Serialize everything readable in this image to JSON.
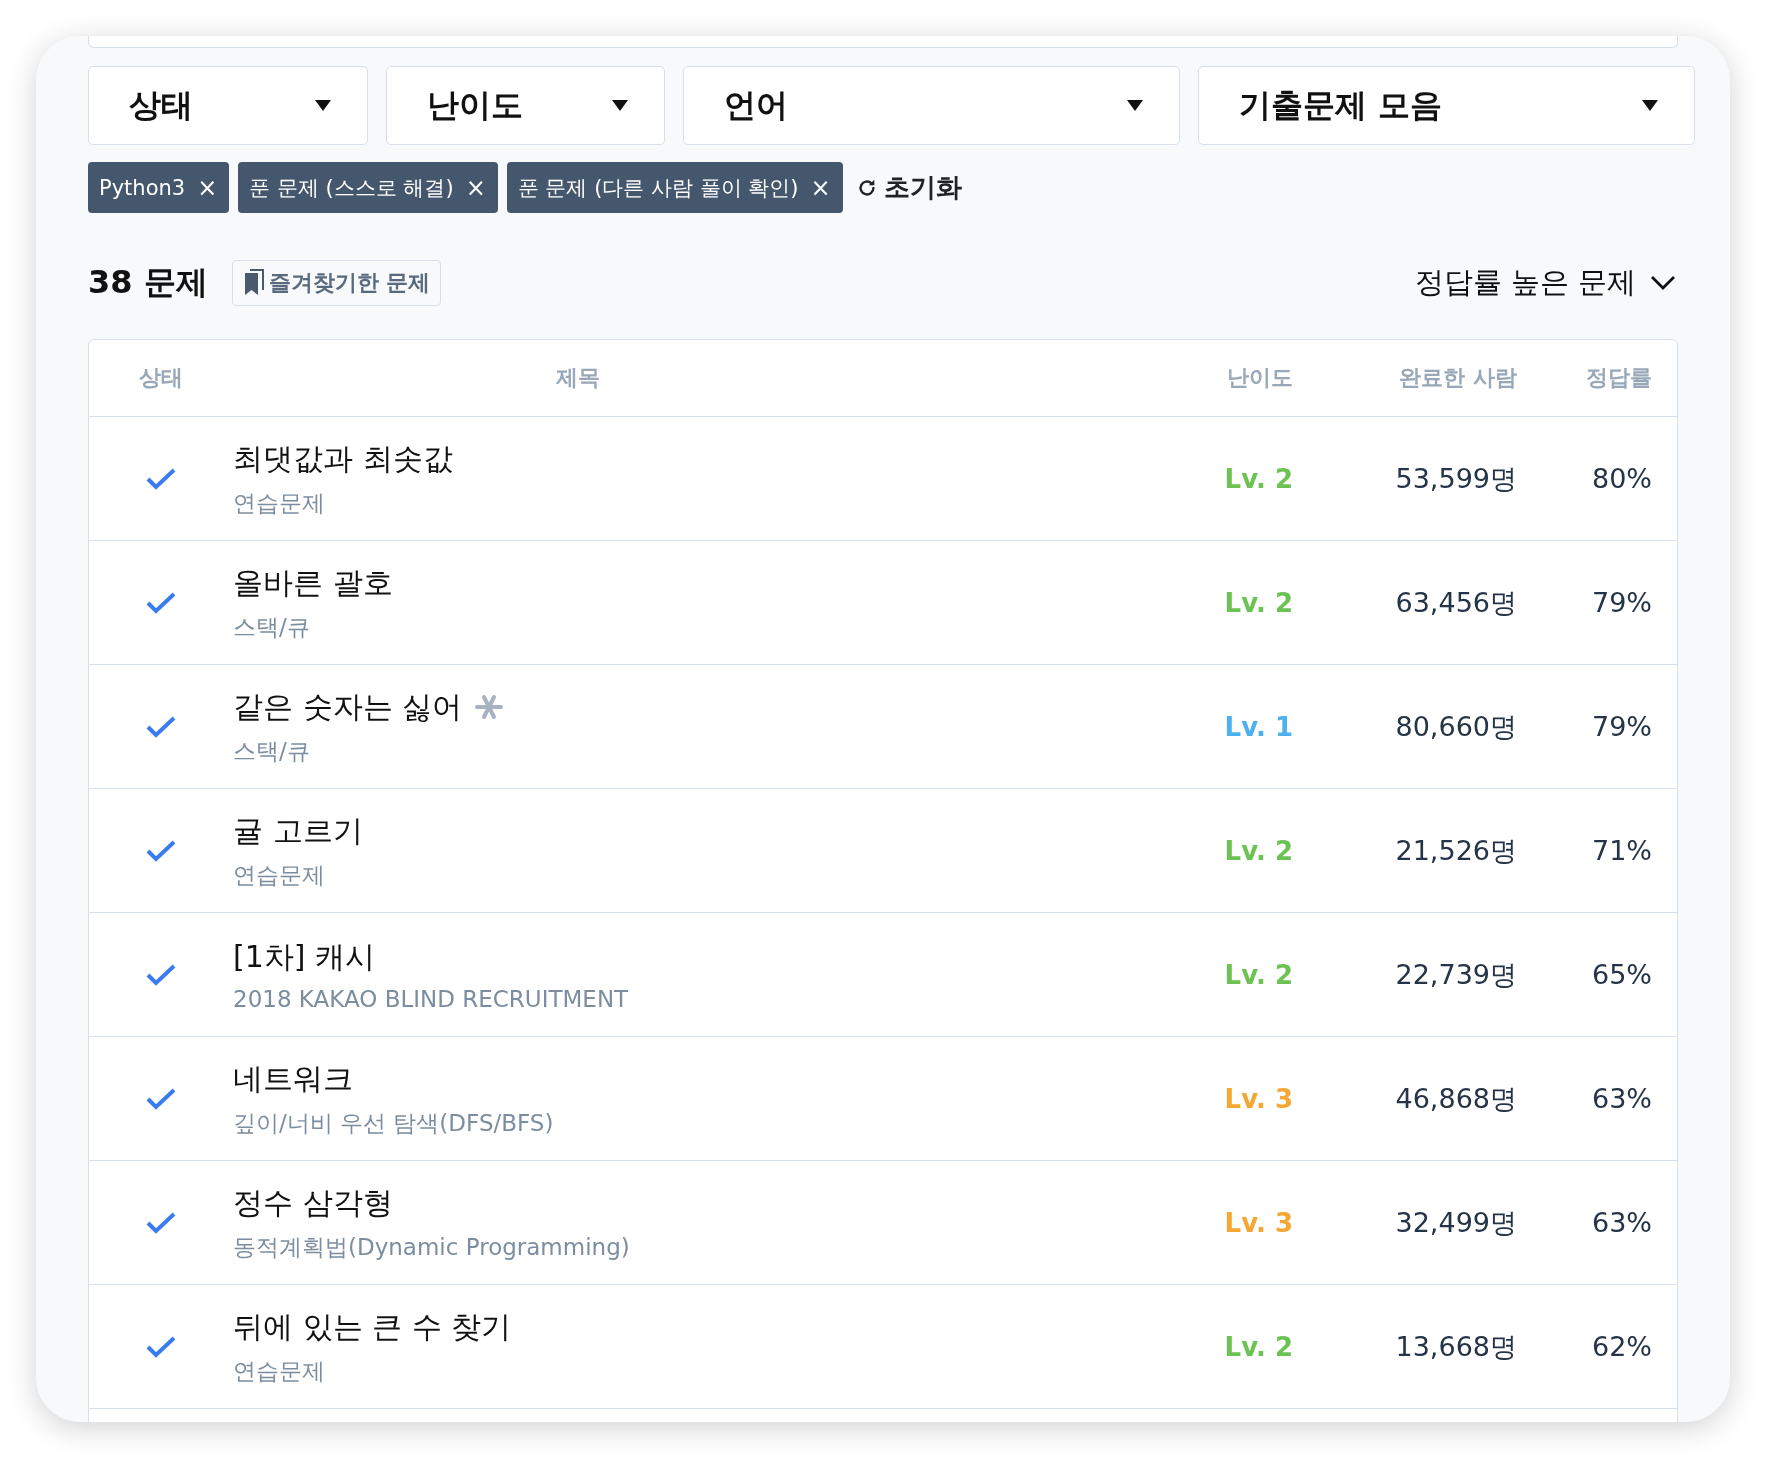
{
  "filters": [
    {
      "label": "상태"
    },
    {
      "label": "난이도"
    },
    {
      "label": "언어"
    },
    {
      "label": "기출문제 모음"
    }
  ],
  "tags": [
    {
      "label": "Python3",
      "remove": "×"
    },
    {
      "label": "푼 문제 (스스로 해결)",
      "remove": "×"
    },
    {
      "label": "푼 문제 (다른 사람 풀이 확인)",
      "remove": "×"
    }
  ],
  "reset": "초기화",
  "count": "38 문제",
  "bookmark": "즐겨찾기한 문제",
  "sort": "정답률 높은 문제",
  "table": {
    "columns": [
      "상태",
      "제목",
      "난이도",
      "완료한 사람",
      "정답률"
    ],
    "rows": [
      {
        "solved": true,
        "title": "최댓값과 최솟값",
        "subtitle": "연습문제",
        "badge": false,
        "difficulty": "Lv. 2",
        "color": "#6cc354",
        "completed": "53,599명",
        "rate": "80%"
      },
      {
        "solved": true,
        "title": "올바른 괄호",
        "subtitle": "스택/큐",
        "badge": false,
        "difficulty": "Lv. 2",
        "color": "#6cc354",
        "completed": "63,456명",
        "rate": "79%"
      },
      {
        "solved": true,
        "title": "같은 숫자는 싫어",
        "subtitle": "스택/큐",
        "badge": true,
        "difficulty": "Lv. 1",
        "color": "#4eb1ef",
        "completed": "80,660명",
        "rate": "79%"
      },
      {
        "solved": true,
        "title": "귤 고르기",
        "subtitle": "연습문제",
        "badge": false,
        "difficulty": "Lv. 2",
        "color": "#6cc354",
        "completed": "21,526명",
        "rate": "71%"
      },
      {
        "solved": true,
        "title": "[1차] 캐시",
        "subtitle": "2018 KAKAO BLIND RECRUITMENT",
        "badge": false,
        "difficulty": "Lv. 2",
        "color": "#6cc354",
        "completed": "22,739명",
        "rate": "65%"
      },
      {
        "solved": true,
        "title": "네트워크",
        "subtitle": "깊이/너비 우선 탐색(DFS/BFS)",
        "badge": false,
        "difficulty": "Lv. 3",
        "color": "#f4a733",
        "completed": "46,868명",
        "rate": "63%"
      },
      {
        "solved": true,
        "title": "정수 삼각형",
        "subtitle": "동적계획법(Dynamic Programming)",
        "badge": false,
        "difficulty": "Lv. 3",
        "color": "#f4a733",
        "completed": "32,499명",
        "rate": "63%"
      },
      {
        "solved": true,
        "title": "뒤에 있는 큰 수 찾기",
        "subtitle": "연습문제",
        "badge": false,
        "difficulty": "Lv. 2",
        "color": "#6cc354",
        "completed": "13,668명",
        "rate": "62%"
      }
    ]
  }
}
